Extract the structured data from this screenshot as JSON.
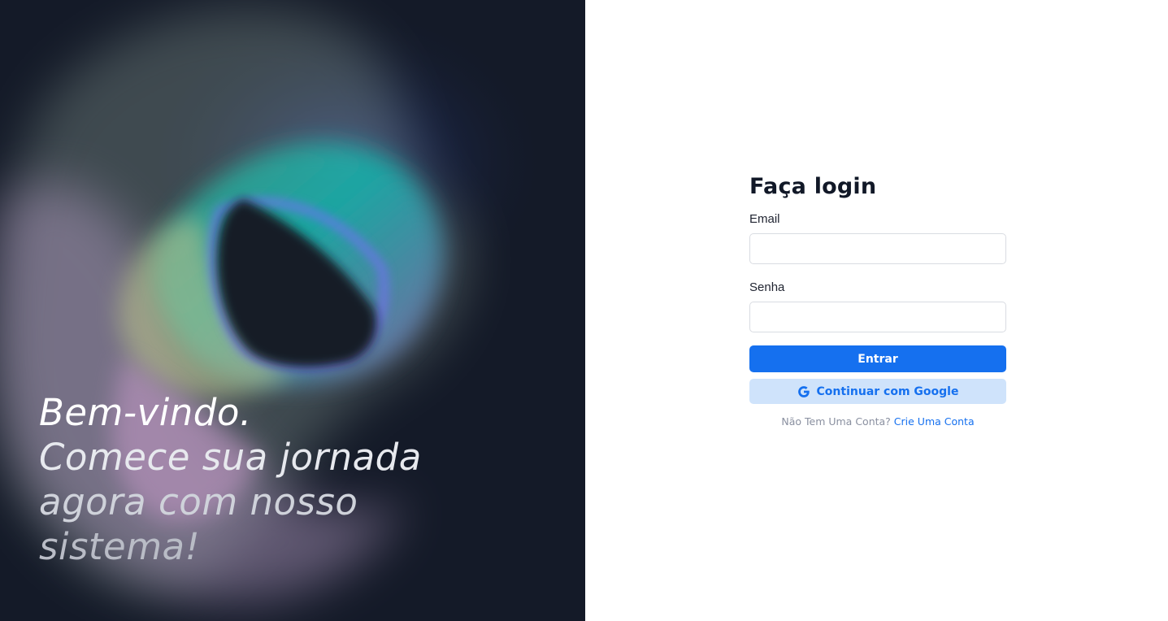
{
  "hero": {
    "line1": "Bem-vindo.",
    "line2": "Comece sua jornada",
    "line3": "agora com nosso",
    "line4": "sistema!"
  },
  "login": {
    "title": "Faça login",
    "email_label": "Email",
    "email_value": "",
    "password_label": "Senha",
    "password_value": "",
    "submit_label": "Entrar",
    "google_label": "Continuar com Google",
    "google_icon": "google-g-icon",
    "signup_prompt": "Não Tem Uma Conta?",
    "signup_link": "Crie Uma Conta"
  },
  "colors": {
    "hero_bg": "#141a28",
    "primary": "#1570ef",
    "google_bg": "#cfe3fb",
    "title": "#111827"
  }
}
